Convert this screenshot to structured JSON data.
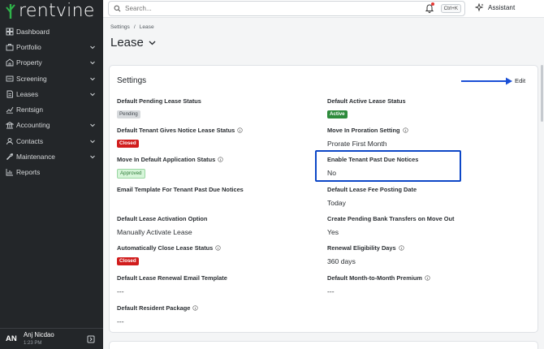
{
  "brand": {
    "name": "rentvine",
    "accent": "#2e8b3c"
  },
  "sidebar": {
    "items": [
      {
        "label": "Dashboard",
        "icon": "dashboard-icon",
        "expandable": false
      },
      {
        "label": "Portfolio",
        "icon": "portfolio-icon",
        "expandable": true
      },
      {
        "label": "Property",
        "icon": "property-icon",
        "expandable": true
      },
      {
        "label": "Screening",
        "icon": "screening-icon",
        "expandable": true
      },
      {
        "label": "Leases",
        "icon": "leases-icon",
        "expandable": true
      },
      {
        "label": "Rentsign",
        "icon": "rentsign-icon",
        "expandable": false
      },
      {
        "label": "Accounting",
        "icon": "accounting-icon",
        "expandable": true
      },
      {
        "label": "Contacts",
        "icon": "contacts-icon",
        "expandable": true
      },
      {
        "label": "Maintenance",
        "icon": "maintenance-icon",
        "expandable": true
      },
      {
        "label": "Reports",
        "icon": "reports-icon",
        "expandable": false
      }
    ],
    "user": {
      "initials": "AN",
      "name": "Anj Nicdao",
      "time": "1:23 PM"
    }
  },
  "topbar": {
    "search_placeholder": "Search...",
    "shortcut": "Ctrl+K",
    "assistant_label": "Assistant"
  },
  "breadcrumb": {
    "parent": "Settings",
    "separator": "/",
    "current": "Lease"
  },
  "page_title": "Lease",
  "settings": {
    "title": "Settings",
    "edit_label": "Edit",
    "fields": [
      {
        "label": "Default Pending Lease Status",
        "value": "Pending",
        "badge": "pending",
        "info": false
      },
      {
        "label": "Default Active Lease Status",
        "value": "Active",
        "badge": "active",
        "info": false
      },
      {
        "label": "Default Tenant Gives Notice Lease Status",
        "value": "Closed",
        "badge": "closed",
        "info": true
      },
      {
        "label": "Move In Proration Setting",
        "value": "Prorate First Month",
        "badge": "",
        "info": true
      },
      {
        "label": "Move In Default Application Status",
        "value": "Approved",
        "badge": "approved",
        "info": true
      },
      {
        "label": "Enable Tenant Past Due Notices",
        "value": "No",
        "badge": "",
        "info": false
      },
      {
        "label": "Email Template For Tenant Past Due Notices",
        "value": "",
        "badge": "",
        "info": false
      },
      {
        "label": "Default Lease Fee Posting Date",
        "value": "Today",
        "badge": "",
        "info": false
      },
      {
        "label": "Default Lease Activation Option",
        "value": "Manually Activate Lease",
        "badge": "",
        "info": false
      },
      {
        "label": "Create Pending Bank Transfers on Move Out",
        "value": "Yes",
        "badge": "",
        "info": false
      },
      {
        "label": "Automatically Close Lease Status",
        "value": "Closed",
        "badge": "closed",
        "info": true
      },
      {
        "label": "Renewal Eligibility Days",
        "value": "360 days",
        "badge": "",
        "info": true
      },
      {
        "label": "Default Lease Renewal Email Template",
        "value": "---",
        "badge": "",
        "info": false
      },
      {
        "label": "Default Month-to-Month Premium",
        "value": "---",
        "badge": "",
        "info": true
      },
      {
        "label": "Default Resident Package",
        "value": "---",
        "badge": "",
        "info": true
      }
    ]
  }
}
